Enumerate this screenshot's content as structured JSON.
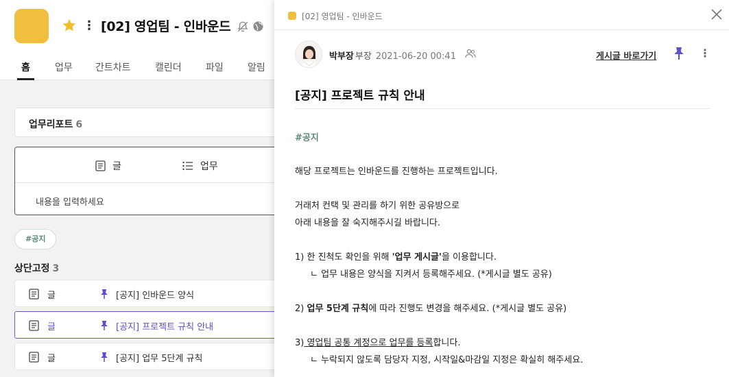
{
  "project": {
    "title": "[02] 영업팀 - 인바운드",
    "logo_color": "#f0bf3f"
  },
  "tabs": [
    "홈",
    "업무",
    "간트차트",
    "캘린더",
    "파일",
    "알림"
  ],
  "report": {
    "label": "업무리포트",
    "count": "6"
  },
  "composer": {
    "tab_post": "글",
    "tab_task": "업무",
    "placeholder": "내용을 입력하세요"
  },
  "hashtag": "#공지",
  "pinned": {
    "label": "상단고정",
    "count": "3",
    "items": [
      {
        "kind": "글",
        "title": "[공지] 인바운드 양식"
      },
      {
        "kind": "글",
        "title": "[공지] 프로젝트 규칙 안내"
      },
      {
        "kind": "글",
        "title": "[공지] 업무 5단계 규칙"
      }
    ]
  },
  "detail": {
    "breadcrumb": "[02] 영업팀 - 인바운드",
    "author_name": "박부장",
    "author_rank": "부장",
    "date": "2021-06-20 00:41",
    "shortcut_label": "게시글 바로가기",
    "title": "[공지] 프로젝트 규칙 안내",
    "tag": "#공지",
    "intro": "해당 프로젝트는 인바운드를 진행하는 프로젝트입니다.",
    "para1": "거래처 컨택 및 관리를 하기 위한 공유방으로",
    "para2": "아래 내용을 잘 숙지해주시길 바랍니다.",
    "rule1_a": "1) 한 진척도 확인을 위해 ",
    "rule1_b": "'업무 게시글'",
    "rule1_c": "을 이용합니다.",
    "rule1_sub": "ㄴ 업무 내용은 양식을 지켜서 등록해주세요. (*게시글 별도 공유)",
    "rule2_a": "2) ",
    "rule2_b": "업무 5단계 규칙",
    "rule2_c": "에 따라 진행도 변경을 해주세요. (*게시글 별도 공유)",
    "rule3_a": "3)",
    "rule3_b": " 영업팀 공통 계정으로 업무를 등록",
    "rule3_c": "합니다.",
    "rule3_sub": "ㄴ 누락되지 않도록 담당자 지정, 시작일&마감일 지정은 확실히 해주세요."
  },
  "colors": {
    "accent": "#5b4fcf",
    "tag": "#5b8a78",
    "project": "#f0bf3f"
  }
}
